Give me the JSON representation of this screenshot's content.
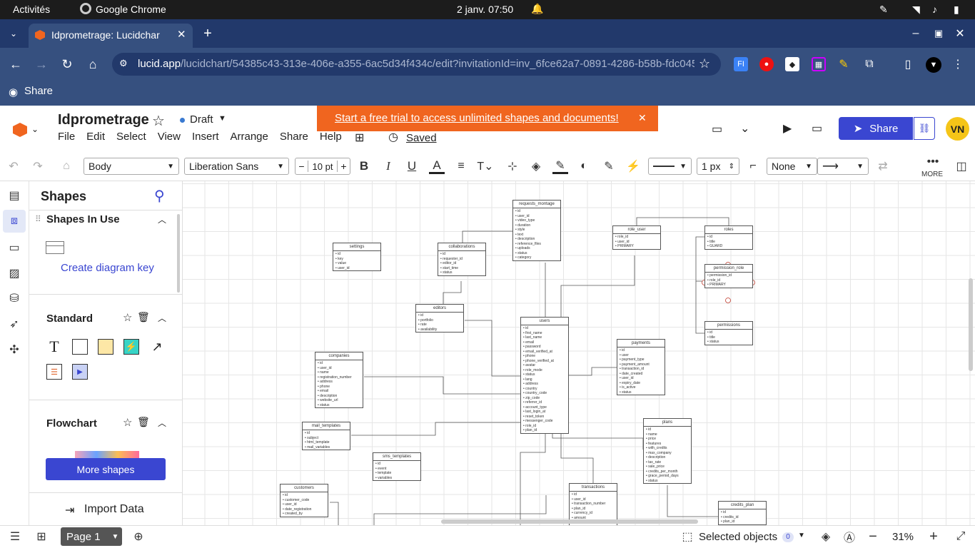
{
  "os": {
    "activities": "Activités",
    "app": "Google Chrome",
    "clock": "2 janv.  07:50"
  },
  "browser": {
    "tab_title": "Idprometrage: Lucidchar",
    "url_host": "lucid.app",
    "url_path": "/lucidchart/54385c43-313e-406e-a355-6ac5d34f434c/edit?invitationId=inv_6fce62a7-0891-4286-b58b-fdc0458f4...",
    "share_label": "Share"
  },
  "app": {
    "doc_title": "Idprometrage",
    "status": "Draft",
    "trial_banner": "Start a free trial to access unlimited shapes and documents!",
    "menus": [
      "File",
      "Edit",
      "Select",
      "View",
      "Insert",
      "Arrange",
      "Share",
      "Help"
    ],
    "saved": "Saved",
    "share_btn": "Share",
    "avatar": "VN"
  },
  "toolbar": {
    "style": "Body",
    "font": "Liberation Sans",
    "size": "10 pt",
    "line_width": "1 px",
    "line_start": "None",
    "more": "MORE"
  },
  "panel": {
    "title": "Shapes",
    "in_use": "Shapes In Use",
    "create_key": "Create diagram key",
    "standard": "Standard",
    "flowchart": "Flowchart",
    "more_shapes": "More shapes",
    "import_data": "Import Data"
  },
  "bottom": {
    "page": "Page 1",
    "selected": "Selected objects",
    "selected_count": "0",
    "zoom": "31%"
  },
  "colors": {
    "banner": "#f0651f",
    "brand": "#3a46d1",
    "chrome_dark": "#22396b",
    "chrome_mid": "#36507f"
  },
  "entities": [
    {
      "title": "requests_montage",
      "rows": [
        "id",
        "user_id",
        "video_type",
        "duration",
        "style",
        "text",
        "description",
        "reference_files",
        "uploads",
        "status",
        "category"
      ]
    },
    {
      "title": "role_user",
      "rows": [
        "role_id",
        "user_id",
        "PRIMARY"
      ]
    },
    {
      "title": "roles",
      "rows": [
        "id",
        "title",
        "GUARD"
      ]
    },
    {
      "title": "settings",
      "rows": [
        "id",
        "key",
        "value",
        "user_id"
      ]
    },
    {
      "title": "collaborations",
      "rows": [
        "id",
        "requester_id",
        "editor_id",
        "start_time",
        "status"
      ]
    },
    {
      "title": "permission_role",
      "rows": [
        "permission_id",
        "role_id",
        "PRIMARY"
      ]
    },
    {
      "title": "editors",
      "rows": [
        "id",
        "portfolio",
        "rate",
        "availability"
      ]
    },
    {
      "title": "users",
      "rows": [
        "id",
        "first_name",
        "last_name",
        "email",
        "password",
        "email_verified_at",
        "phone",
        "phone_verified_at",
        "avatar",
        "role_mode",
        "status",
        "lang",
        "address",
        "country",
        "country_code",
        "zip_code",
        "referrer_id",
        "account_type",
        "last_login_at",
        "reset_token",
        "messenger_code",
        "role_id",
        "plan_id"
      ]
    },
    {
      "title": "permissions",
      "rows": [
        "id",
        "title",
        "status"
      ]
    },
    {
      "title": "payments",
      "rows": [
        "id",
        "user",
        "payment_type",
        "payment_amount",
        "transaction_id",
        "date_created",
        "user_id",
        "expiry_date",
        "is_active",
        "status"
      ]
    },
    {
      "title": "companies",
      "rows": [
        "id",
        "user_id",
        "name",
        "registration_number",
        "address",
        "phone",
        "email",
        "description",
        "website_url",
        "status"
      ]
    },
    {
      "title": "mail_templates",
      "rows": [
        "id",
        "subject",
        "html_template",
        "mail_variables"
      ]
    },
    {
      "title": "sms_templates",
      "rows": [
        "id",
        "event",
        "template",
        "variables"
      ]
    },
    {
      "title": "plans",
      "rows": [
        "id",
        "name",
        "price",
        "features",
        "with_credits",
        "max_company",
        "description",
        "tax_rate",
        "sale_price",
        "credits_per_month",
        "grace_period_days",
        "status"
      ]
    },
    {
      "title": "customers",
      "rows": [
        "id",
        "customer_code",
        "user_id",
        "date_registration",
        "created_by"
      ]
    },
    {
      "title": "transactions",
      "rows": [
        "id",
        "user_id",
        "transaction_number",
        "plan_id",
        "currency_id",
        "amount",
        "currency_code"
      ]
    },
    {
      "title": "credits_plan",
      "rows": [
        "id",
        "credits_id",
        "plan_id"
      ]
    }
  ]
}
